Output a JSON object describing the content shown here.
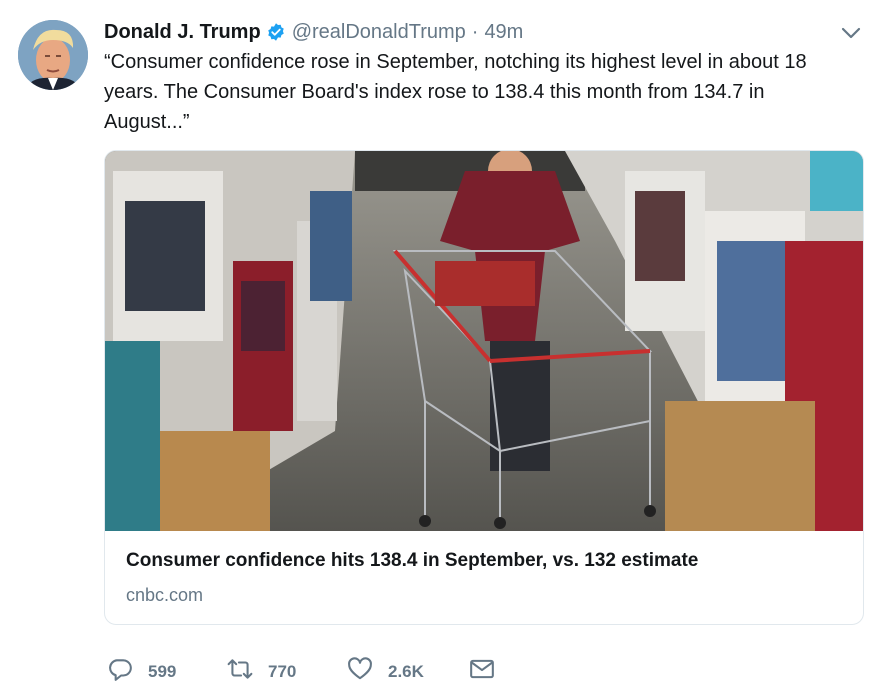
{
  "tweet": {
    "author_name": "Donald J. Trump",
    "handle": "@realDonaldTrump",
    "separator": "·",
    "time": "49m",
    "text": "“Consumer confidence rose in September, notching its highest level in about 18 years. The Consumer Board's index rose to 138.4 this month from 134.7 in August...”"
  },
  "card": {
    "title": "Consumer confidence hits 138.4 in September, vs. 132 estimate",
    "domain": "cnbc.com"
  },
  "actions": {
    "replies": "599",
    "retweets": "770",
    "likes": "2.6K"
  },
  "colors": {
    "verified_blue": "#1da1f2",
    "secondary_text": "#657786",
    "card_border": "#e1e8ed"
  },
  "icons": {
    "verified": "verified-badge-icon",
    "caret": "chevron-down-icon",
    "reply": "reply-icon",
    "retweet": "retweet-icon",
    "like": "heart-icon",
    "dm": "envelope-icon"
  }
}
